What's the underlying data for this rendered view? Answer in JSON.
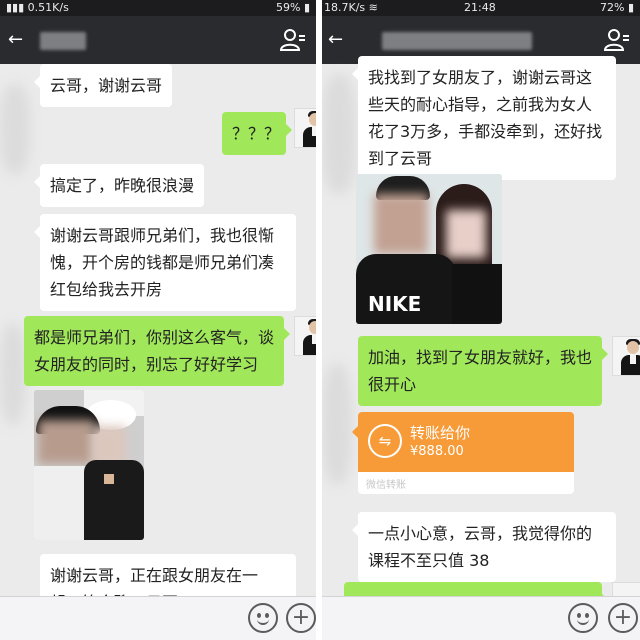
{
  "status_bar": {
    "left_speed": "0.51K/s",
    "battery_left": "59%",
    "mid_speed": "18.7K/s",
    "time": "21:48",
    "battery_right": "72%"
  },
  "left_chat": {
    "messages": [
      {
        "side": "in",
        "text": "云哥，谢谢云哥"
      },
      {
        "side": "out",
        "text": "？？？"
      },
      {
        "side": "in",
        "text": "搞定了，昨晚很浪漫"
      },
      {
        "side": "in",
        "text": "谢谢云哥跟师兄弟们，我也很惭愧，开个房的钱都是师兄弟们凑红包给我去开房"
      },
      {
        "side": "out",
        "text": "都是师兄弟们，你别这么客气，谈女朋友的同时，别忘了好好学习"
      },
      {
        "side": "in",
        "text": "谢谢云哥，正在跟女朋友在一起，等会聊，云哥"
      }
    ]
  },
  "right_chat": {
    "messages": [
      {
        "side": "in",
        "text": "我找到了女朋友了，谢谢云哥这些天的耐心指导，之前我为女人花了3万多，手都没牵到，还好找到了云哥"
      },
      {
        "side": "out",
        "text": "加油，找到了女朋友就好，我也很开心"
      },
      {
        "side": "in",
        "text": "一点小心意，云哥，我觉得你的课程不至只值   38"
      }
    ],
    "transfer": {
      "title": "转账给你",
      "amount": "¥888.00",
      "label": "微信转账"
    },
    "photo_shirt_text": "NIKE"
  },
  "colors": {
    "title_bar": "#2a2b2f",
    "chat_bg": "#ebebeb",
    "bubble_out": "#a0e75a",
    "bubble_in": "#ffffff",
    "transfer": "#f79b38"
  },
  "icons": [
    "back-arrow-icon",
    "contact-icon",
    "emoji-icon",
    "plus-icon",
    "transfer-icon",
    "wifi-icon",
    "signal-icon",
    "battery-icon"
  ]
}
